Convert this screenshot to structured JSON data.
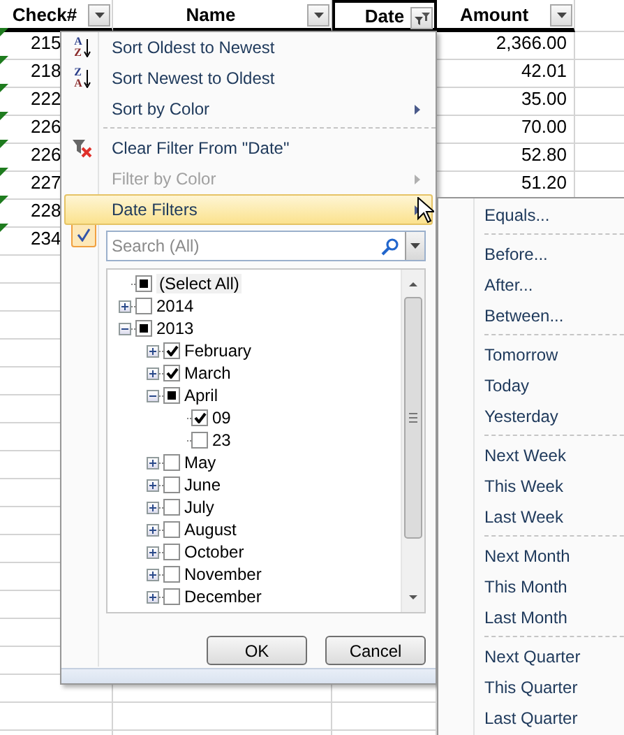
{
  "sheet": {
    "columns": [
      {
        "label": "Check#",
        "filtered": false,
        "selected": false
      },
      {
        "label": "Name",
        "filtered": false,
        "selected": false
      },
      {
        "label": "Date",
        "filtered": true,
        "selected": true
      },
      {
        "label": "Amount",
        "filtered": false,
        "selected": false
      }
    ],
    "rows": [
      {
        "check": "215",
        "amount": "2,366.00",
        "error_mark": true
      },
      {
        "check": "218",
        "amount": "42.01",
        "error_mark": true
      },
      {
        "check": "222",
        "amount": "35.00",
        "error_mark": true
      },
      {
        "check": "226",
        "amount": "70.00",
        "error_mark": true
      },
      {
        "check": "226",
        "amount": "52.80",
        "error_mark": true
      },
      {
        "check": "227",
        "amount": "51.20",
        "error_mark": true
      },
      {
        "check": "228",
        "error_mark": true
      },
      {
        "check": "234",
        "error_mark": true
      }
    ]
  },
  "filter_menu": {
    "groups": [
      [
        {
          "label": "Sort Oldest to Newest",
          "kind": "sort",
          "icon_text": [
            "A",
            "Z"
          ],
          "disabled": false,
          "highlighted": false,
          "has_submenu": false
        },
        {
          "label": "Sort Newest to Oldest",
          "kind": "sort",
          "icon_text": [
            "Z",
            "A"
          ],
          "disabled": false,
          "highlighted": false,
          "has_submenu": false
        },
        {
          "label": "Sort by Color",
          "kind": "plain",
          "disabled": false,
          "highlighted": false,
          "has_submenu": true
        }
      ],
      [
        {
          "label": "Clear Filter From \"Date\"",
          "kind": "clear",
          "disabled": false,
          "highlighted": false,
          "has_submenu": false
        },
        {
          "label": "Filter by Color",
          "kind": "plain",
          "disabled": true,
          "highlighted": false,
          "has_submenu": true
        },
        {
          "label": "Date Filters",
          "kind": "plain",
          "disabled": false,
          "highlighted": true,
          "has_submenu": true
        }
      ]
    ],
    "filter_active": true,
    "search": {
      "placeholder": "Search (All)"
    },
    "select_all": {
      "label": "(Select All)",
      "checked": false,
      "mixed": true
    },
    "tree": [
      {
        "label": "2014",
        "checked": false,
        "expanded": false
      },
      {
        "label": "2013",
        "checked": false,
        "mixed": true,
        "expanded": true,
        "children": [
          {
            "label": "February",
            "checked": true,
            "expanded": false
          },
          {
            "label": "March",
            "checked": true,
            "expanded": false
          },
          {
            "label": "April",
            "checked": false,
            "mixed": true,
            "expanded": true,
            "children": [
              {
                "label": "09",
                "checked": true
              },
              {
                "label": "23",
                "checked": false
              }
            ]
          },
          {
            "label": "May",
            "checked": false,
            "expanded": false
          },
          {
            "label": "June",
            "checked": false,
            "expanded": false
          },
          {
            "label": "July",
            "checked": false,
            "expanded": false
          },
          {
            "label": "August",
            "checked": false,
            "expanded": false
          },
          {
            "label": "October",
            "checked": false,
            "expanded": false
          },
          {
            "label": "November",
            "checked": false,
            "expanded": false
          },
          {
            "label": "December",
            "checked": false,
            "expanded": false
          }
        ]
      }
    ],
    "buttons": [
      "OK",
      "Cancel"
    ]
  },
  "date_filters_submenu": {
    "groups": [
      [
        "Equals..."
      ],
      [
        "Before...",
        "After...",
        "Between..."
      ],
      [
        "Tomorrow",
        "Today",
        "Yesterday"
      ],
      [
        "Next Week",
        "This Week",
        "Last Week"
      ],
      [
        "Next Month",
        "This Month",
        "Last Month"
      ],
      [
        "Next Quarter",
        "This Quarter",
        "Last Quarter"
      ]
    ]
  }
}
